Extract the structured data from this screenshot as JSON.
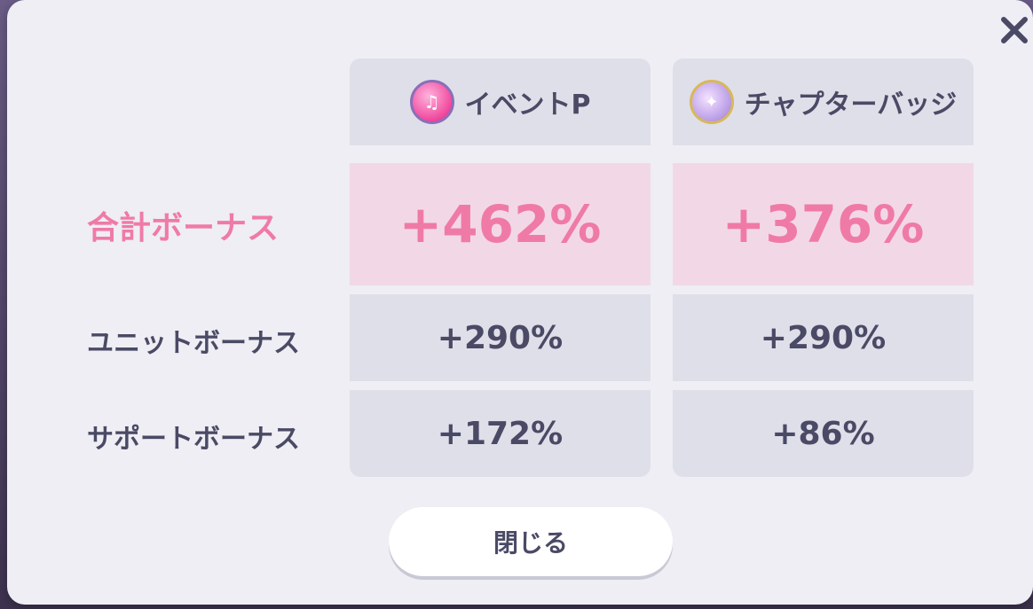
{
  "columns": [
    {
      "label": "イベントP",
      "icon": "event-point-icon"
    },
    {
      "label": "チャプターバッジ",
      "icon": "chapter-badge-icon"
    }
  ],
  "rows": {
    "total": {
      "label": "合計ボーナス",
      "values": [
        "+462%",
        "+376%"
      ]
    },
    "unit": {
      "label": "ユニットボーナス",
      "values": [
        "+290%",
        "+290%"
      ]
    },
    "support": {
      "label": "サポートボーナス",
      "values": [
        "+172%",
        "+86%"
      ]
    }
  },
  "close_button_label": "閉じる",
  "colors": {
    "accent_pink": "#f07aa6",
    "total_bg": "#f2d8e6",
    "cell_bg": "#dfdfe9",
    "text_dark": "#4a4a66"
  }
}
